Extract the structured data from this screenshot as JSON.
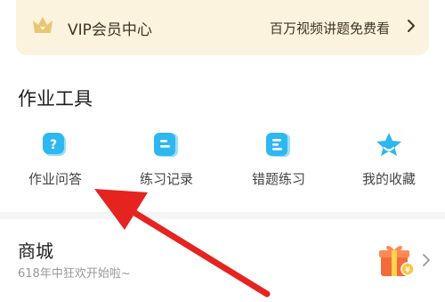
{
  "vip": {
    "title": "VIP会员中心",
    "promo": "百万视频讲题免费看"
  },
  "tools": {
    "heading": "作业工具",
    "items": [
      {
        "label": "作业问答",
        "icon": "question-icon"
      },
      {
        "label": "练习记录",
        "icon": "practice-record-icon"
      },
      {
        "label": "错题练习",
        "icon": "wrong-questions-icon"
      },
      {
        "label": "我的收藏",
        "icon": "favorites-star-icon"
      }
    ]
  },
  "shop": {
    "title": "商城",
    "subtitle": "618年中狂欢开始啦~"
  },
  "colors": {
    "accent_blue": "#2fb8f0",
    "vip_bg": "#fbf3de",
    "arrow_red": "#e52420",
    "gift_orange": "#f36b3a"
  }
}
